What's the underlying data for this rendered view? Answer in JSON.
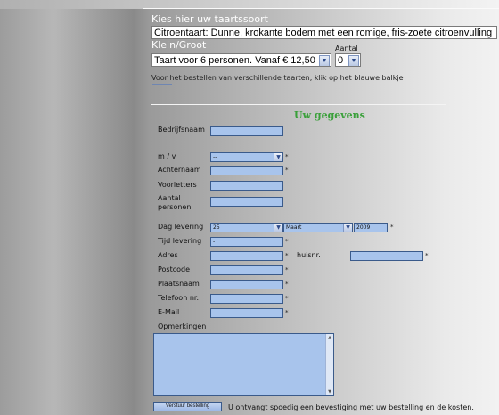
{
  "product": {
    "title": "Kies hier uw taartssoort",
    "selected": "Citroentaart: Dunne, krokante bodem met een romige, fris-zoete citroenvulling"
  },
  "size": {
    "title": "Klein/Groot",
    "selected": "Taart voor 6 personen. Vanaf € 12,50",
    "amount_label": "Aantal",
    "amount_value": "0",
    "hint": "Voor het bestellen van verschillende taarten, klik op het blauwe balkje"
  },
  "form": {
    "heading": "Uw gegevens",
    "bedrijfsnaam": "Bedrijfsnaam",
    "mv_label": "m / v",
    "mv_value": "--",
    "achternaam": "Achternaam",
    "voorletters": "Voorletters",
    "aantal_line1": "Aantal",
    "aantal_line2": "personen",
    "dag_label": "Dag levering",
    "dag_value": "25",
    "maand_value": "Maart",
    "jaar_value": "2009",
    "tijd_label": "Tijd levering",
    "tijd_value": "-",
    "adres": "Adres",
    "huisnr": "huisnr.",
    "postcode": "Postcode",
    "plaatsnaam": "Plaatsnaam",
    "telefoon": "Telefoon nr.",
    "email": "E-Mail",
    "opmerkingen": "Opmerkingen",
    "required_mark": "*",
    "submit": "Verstuur bestelling",
    "confirm_text": "U ontvangt spoedig een bevestiging met uw bestelling en de kosten."
  }
}
